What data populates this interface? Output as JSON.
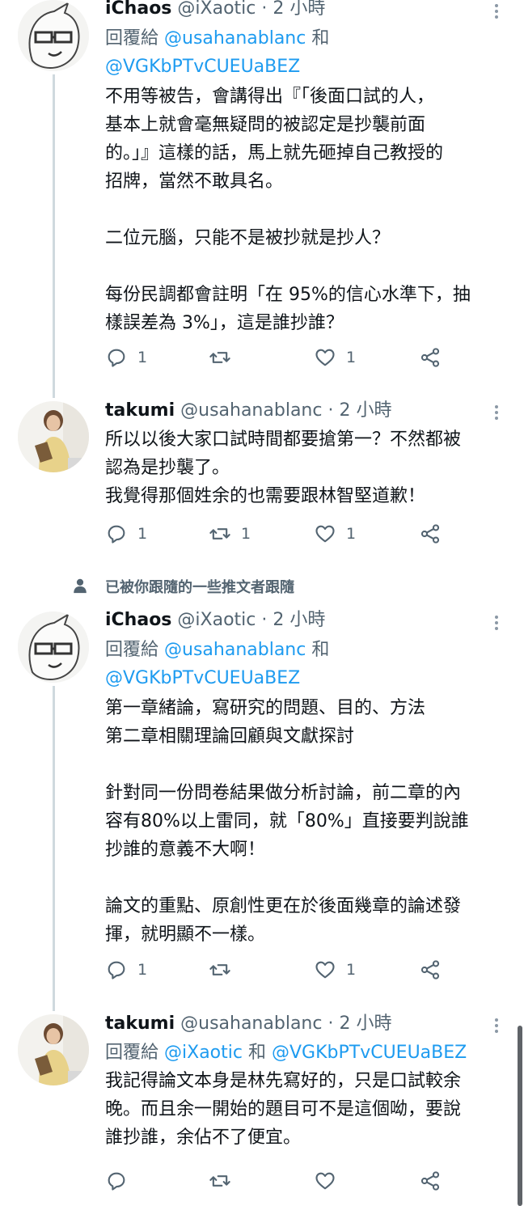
{
  "tweets": [
    {
      "name": "iChaos",
      "handle": "@iXaotic",
      "time": "· 2 小時",
      "reply_prefix": "回覆給",
      "reply_mentions_line1": "@usahanablanc",
      "reply_and": "和",
      "reply_mentions_line2": "@VGKbPTvCUEUaBEZ",
      "text": "不用等被告，會講得出『「後面口試的人，\n基本上就會毫無疑問的被認定是抄襲前面\n的。」』這樣的話，馬上就先砸掉自己教授的\n招牌，當然不敢具名。\n\n二位元腦，只能不是被抄就是抄人？\n\n每份民調都會註明「在 95%的信心水準下，抽\n樣誤差為 3%」，這是誰抄誰？",
      "replies": "1",
      "retweets": "",
      "likes": "1"
    },
    {
      "name": "takumi",
      "handle": "@usahanablanc",
      "time": "· 2 小時",
      "text": "所以以後大家口試時間都要搶第一？不然都被\n認為是抄襲了。\n我覺得那個姓余的也需要跟林智堅道歉！",
      "replies": "1",
      "retweets": "1",
      "likes": "1"
    },
    {
      "social_context": "已被你跟隨的一些推文者跟隨",
      "name": "iChaos",
      "handle": "@iXaotic",
      "time": "· 2 小時",
      "reply_prefix": "回覆給",
      "reply_mentions_line1": "@usahanablanc",
      "reply_and": "和",
      "reply_mentions_line2": "@VGKbPTvCUEUaBEZ",
      "text": "第一章緒論，寫研究的問題、目的、方法\n第二章相關理論回顧與文獻探討\n\n針對同一份問卷結果做分析討論，前二章的內\n容有80%以上雷同，就「80%」直接要判說誰\n抄誰的意義不大啊！\n\n論文的重點、原創性更在於後面幾章的論述發\n揮，就明顯不一樣。",
      "replies": "1",
      "retweets": "",
      "likes": "1"
    },
    {
      "name": "takumi",
      "handle": "@usahanablanc",
      "time": "· 2 小時",
      "reply_prefix": "回覆給",
      "reply_mention_a": "@iXaotic",
      "reply_and": "和",
      "reply_mention_b": "@VGKbPTvCUEUaBEZ",
      "text": "我記得論文本身是林先寫好的，只是口試較余\n晚。而且余一開始的題目可不是這個呦，要說\n誰抄誰，余佔不了便宜。",
      "replies": "",
      "retweets": "",
      "likes": ""
    }
  ],
  "icons": [
    "more-icon",
    "reply-icon",
    "retweet-icon",
    "like-icon",
    "share-icon",
    "person-icon"
  ],
  "colors": {
    "text": "#0f1419",
    "secondary": "#536471",
    "link": "#1d9bf0",
    "thread_line": "#cfd9de"
  }
}
